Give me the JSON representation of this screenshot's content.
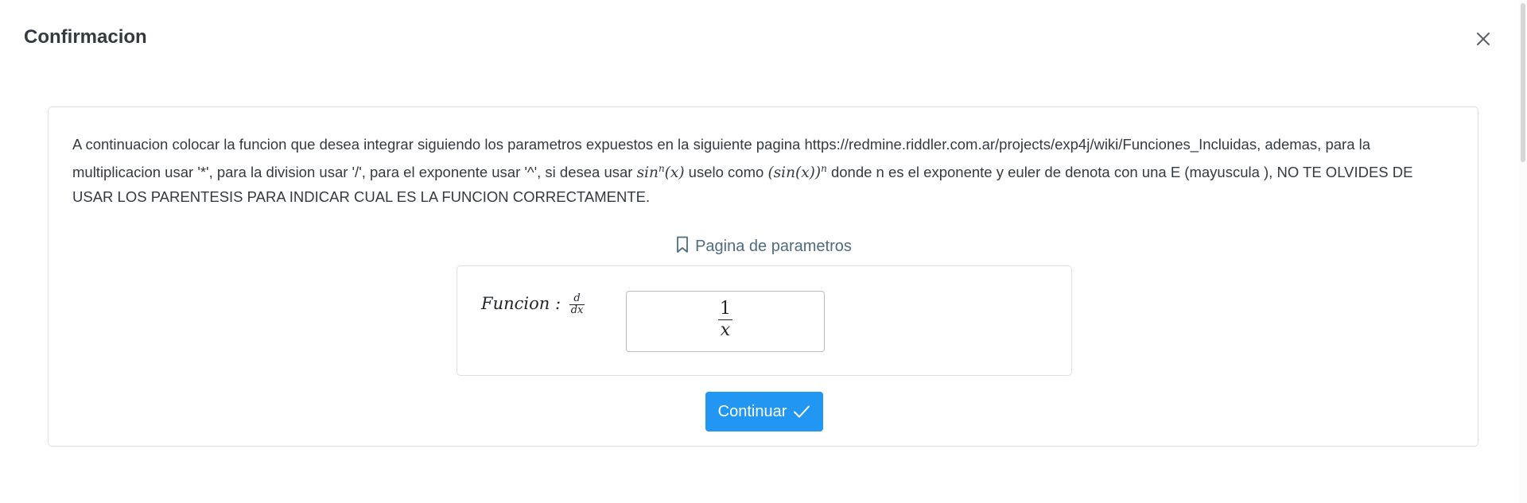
{
  "dialog": {
    "title": "Confirmacion",
    "close_icon": "close-icon"
  },
  "instructions": {
    "part1": "A continuacion colocar la funcion que desea integrar siguiendo los parametros expuestos en la siguiente pagina https://redmine.riddler.com.ar/projects/exp4j/wiki/Funciones_Incluidas, ademas, para la multiplicacion usar '*', para la division usar '/', para el exponente usar '^', si desea usar ",
    "math1_base": "sin",
    "math1_sup": "n",
    "math1_arg": "(x)",
    "part2": " uselo como ",
    "math2_body": "(sin(x))",
    "math2_sup": "n",
    "part3": " donde n es el exponente y euler de denota con una E (mayuscula ), NO TE OLVIDES DE USAR LOS PARENTESIS PARA INDICAR CUAL ES LA FUNCION CORRECTAMENTE."
  },
  "params_link": {
    "label": "Pagina de parametros",
    "icon": "bookmark-icon"
  },
  "function_box": {
    "label": "Funcion :",
    "derivative_num": "d",
    "derivative_den": "dx",
    "input_numerator": "1",
    "input_denominator": "x"
  },
  "continue_button": {
    "label": "Continuar",
    "icon": "check-icon",
    "color": "#2196f3"
  }
}
